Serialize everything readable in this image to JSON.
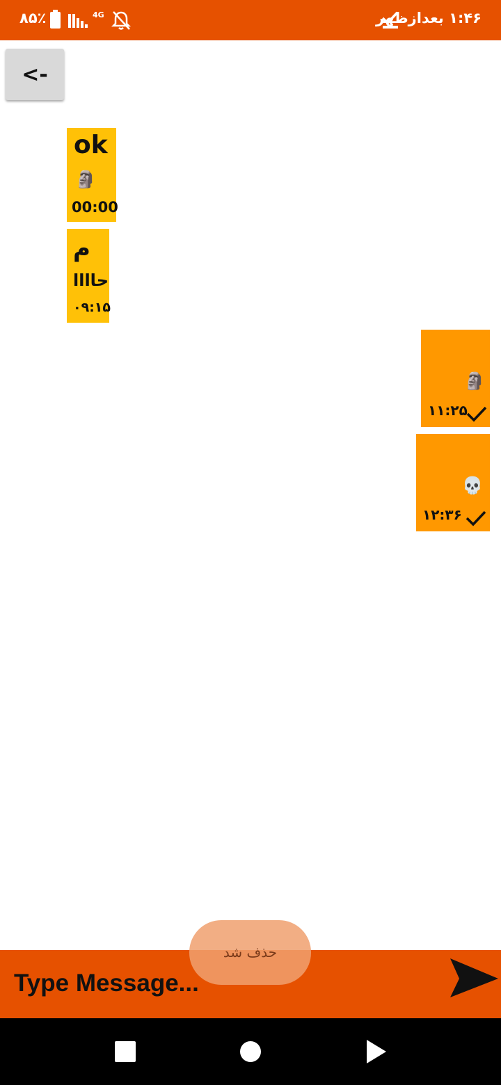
{
  "status_bar": {
    "battery_text": "۸۵٪",
    "network": "4G",
    "time": "۱:۴۶ بعدازظهر",
    "battery_icon": "battery-icon",
    "signal_icon": "signal-icon",
    "bell_icon": "bell-off-icon",
    "check_icon": "download-done-icon"
  },
  "header": {
    "back_label": "<-"
  },
  "messages": [
    {
      "direction": "incoming",
      "text": "ok",
      "emoji": "🗿",
      "time": "00:00"
    },
    {
      "direction": "incoming",
      "text": "م",
      "text2": "حاااا",
      "time": "۰۹:۱۵"
    },
    {
      "direction": "outgoing",
      "emoji": "🗿",
      "time": "۱۱:۲۵",
      "status_icon": "check-icon"
    },
    {
      "direction": "outgoing",
      "emoji": "💀",
      "time": "۱۲:۳۶",
      "status_icon": "check-icon"
    }
  ],
  "composer": {
    "placeholder": "Type Message...",
    "value": "",
    "send_icon": "send-icon"
  },
  "toast": {
    "text": "حذف شد"
  },
  "colors": {
    "primary": "#E65100",
    "incoming_bubble": "#FFC107",
    "outgoing_bubble": "#FF9800",
    "back_button": "#D9D9D9"
  },
  "nav_bar": {
    "recents_icon": "square-icon",
    "home_icon": "circle-icon",
    "back_icon": "triangle-icon"
  }
}
